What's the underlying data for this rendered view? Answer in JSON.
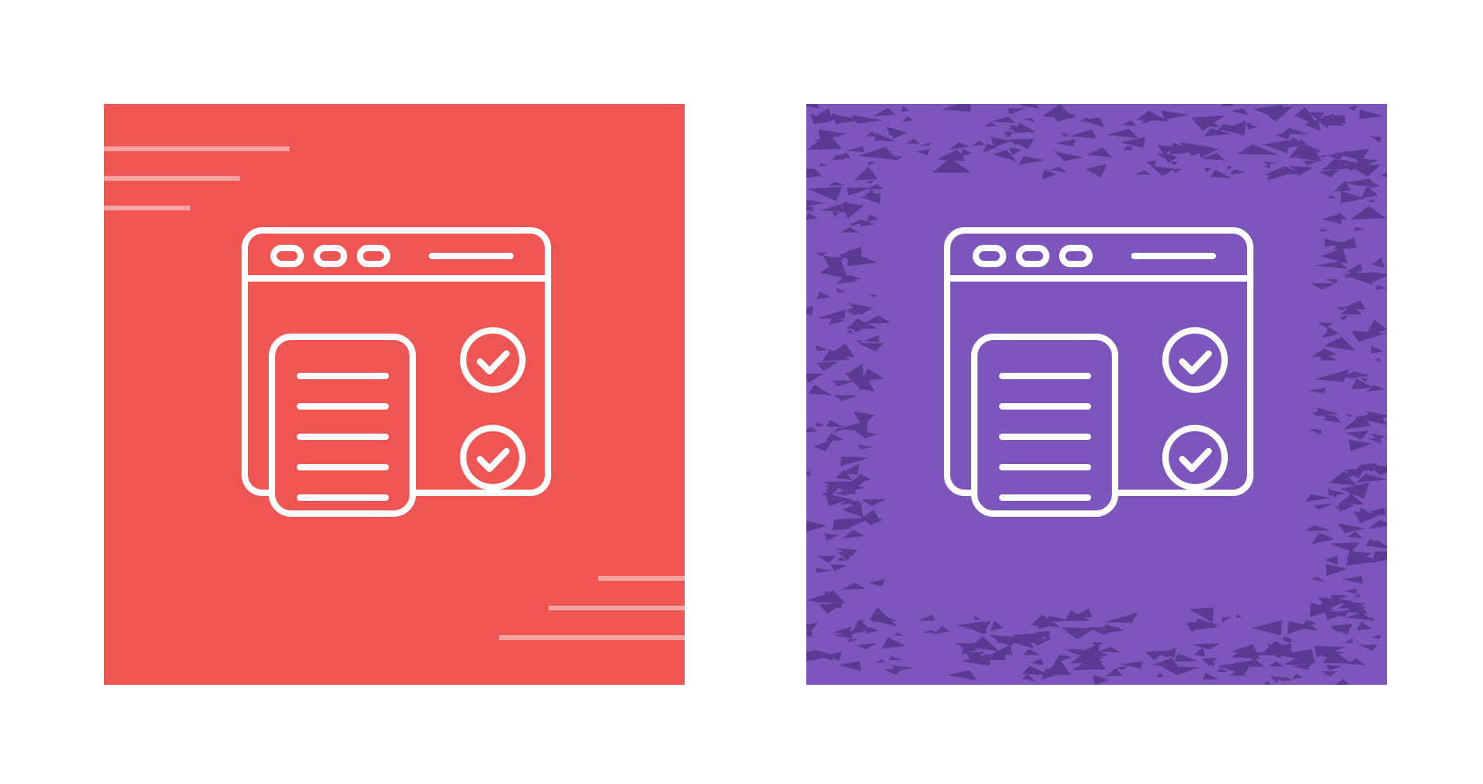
{
  "background_color": "#ffffff",
  "tiles": [
    {
      "name": "red-tile",
      "background": "#ee5553",
      "decoration": "speed-lines",
      "stroke_color": "#ffffff",
      "decor_color": "#f7a3a2",
      "icon": "browser-checklist-icon"
    },
    {
      "name": "purple-tile",
      "background": "#7c56bd",
      "decoration": "grunge-frame",
      "stroke_color": "#ffffff",
      "decor_color": "#5a3a93",
      "icon": "browser-checklist-icon"
    }
  ]
}
